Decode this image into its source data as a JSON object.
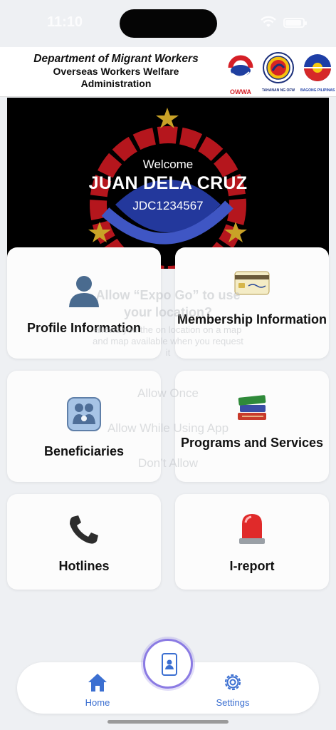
{
  "status_bar": {
    "time": "11:10"
  },
  "header": {
    "department": "Department of Migrant Workers",
    "agency_line1": "Overseas Workers Welfare",
    "agency_line2": "Administration",
    "logos": [
      {
        "icon": "owwa-logo",
        "caption": "OWWA"
      },
      {
        "icon": "dmw-seal",
        "caption": "TAHANAN NG OFW"
      },
      {
        "icon": "bagong-pilipinas-logo",
        "caption": "BAGONG PILIPINAS"
      }
    ]
  },
  "banner": {
    "welcome": "Welcome",
    "name": "JUAN DELA CRUZ",
    "member_id": "JDC1234567"
  },
  "tiles": [
    {
      "label": "Profile Information",
      "icon": "person-icon"
    },
    {
      "label": "Membership Information",
      "icon": "credit-card-icon"
    },
    {
      "label": "Beneficiaries",
      "icon": "family-icon"
    },
    {
      "label": "Programs and Services",
      "icon": "books-icon"
    },
    {
      "label": "Hotlines",
      "icon": "telephone-icon"
    },
    {
      "label": "I-report",
      "icon": "siren-icon"
    }
  ],
  "permission_dialog": {
    "title": "Allow “Expo Go” to use your location?",
    "message": "allows you the on location on a map and map available when you request it",
    "allow_once": "Allow Once",
    "allow_while_using": "Allow While Using App",
    "dont_allow": "Don’t Allow"
  },
  "tabbar": {
    "home": "Home",
    "settings": "Settings",
    "center_icon": "id-card-icon"
  },
  "colors": {
    "accent": "#3b6fd1",
    "fab_ring": "#8b7be3",
    "banner_bg": "#000000"
  }
}
